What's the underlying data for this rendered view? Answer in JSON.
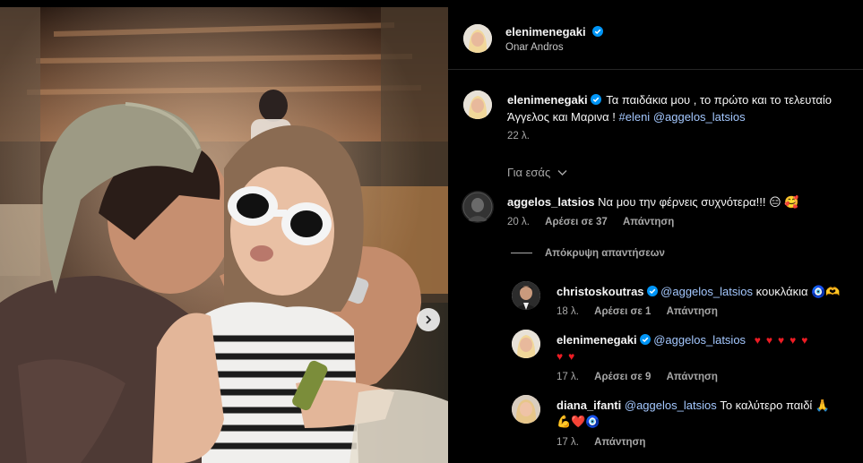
{
  "post_author": {
    "username": "elenimenegaki",
    "location": "Onar Andros"
  },
  "caption": {
    "username": "elenimenegaki",
    "text_line1": "Τα παιδάκια μου , το πρώτο και το τελευταίο",
    "text_line2_plain": "Άγγελος και Μαρινα ! ",
    "hashtag": "#eleni",
    "mention": "@aggelos_latsios",
    "time": "22 λ."
  },
  "for_you": {
    "label": "Για εσάς"
  },
  "comments": [
    {
      "username": "aggelos_latsios",
      "text": "Να μου την φέρνεις συχνότερα!!! 😑 🥰",
      "time": "20 λ.",
      "likes": "Αρέσει σε 37",
      "reply": "Απάντηση"
    }
  ],
  "hide_replies": "Απόκρυψη απαντήσεων",
  "replies": [
    {
      "username": "christoskoutras",
      "mention": "@aggelos_latsios",
      "text": "κουκλάκια 🧿🫶",
      "time": "18 λ.",
      "likes": "Αρέσει σε 1",
      "reply": "Απάντηση"
    },
    {
      "username": "elenimenegaki",
      "mention": "@aggelos_latsios",
      "text": "",
      "hearts_line1": 5,
      "hearts_line2": 2,
      "time": "17 λ.",
      "likes": "Αρέσει σε 9",
      "reply": "Απάντηση"
    },
    {
      "username": "diana_ifanti",
      "mention": "@aggelos_latsios",
      "text": "Το καλύτερο παιδί 🙏",
      "text_line2": "💪❤️🧿",
      "time": "17 λ.",
      "reply": "Απάντηση"
    }
  ],
  "icons": {
    "verified": "verified-badge-icon",
    "next": "chevron-right-icon",
    "expand": "chevron-down-icon"
  },
  "colors": {
    "background": "#000000",
    "verified": "#0095f6",
    "link": "#a4c8ff",
    "heart": "#ed1c24",
    "muted": "#a8a8a8"
  }
}
